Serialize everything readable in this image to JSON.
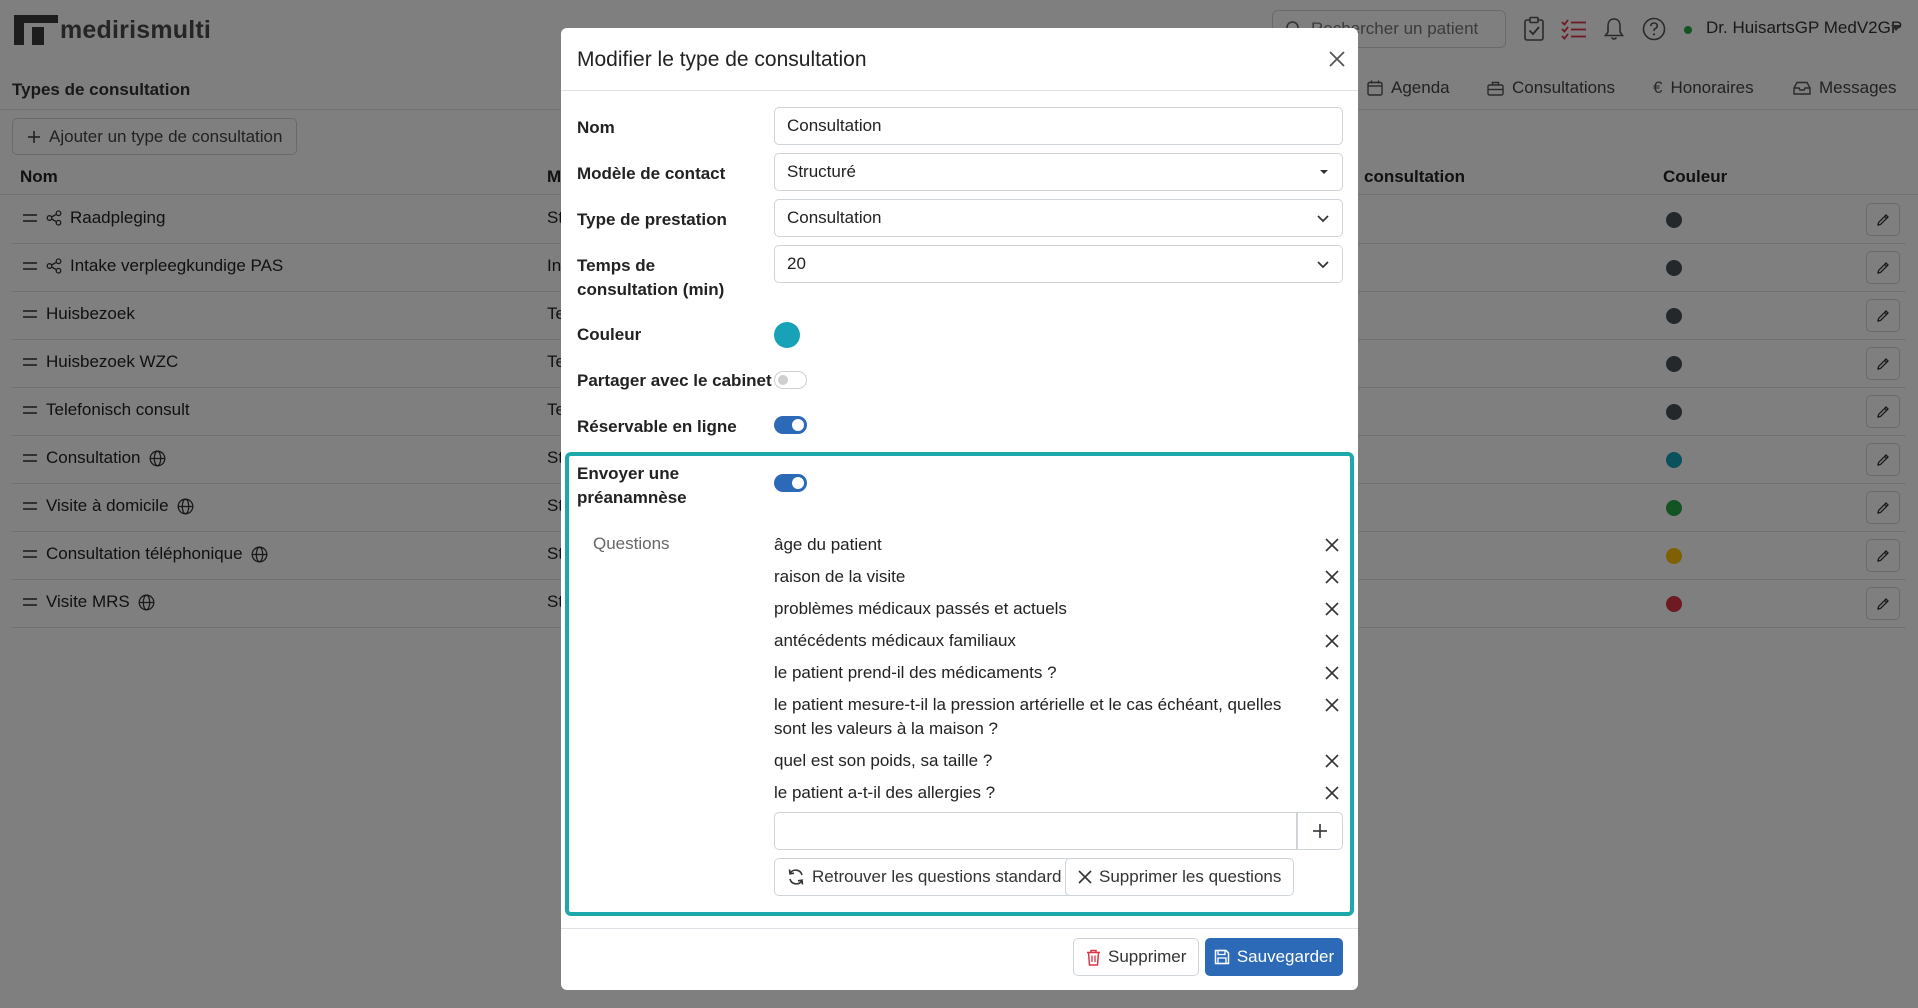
{
  "app": {
    "logo_bold": "medirismulti",
    "search_placeholder": "Rechercher un patient",
    "user_name": "Dr. HuisartsGP MedV2GP",
    "page_heading": "Types de consultation",
    "nav_tabs": [
      "Agenda",
      "Consultations",
      "Honoraires",
      "Messages"
    ],
    "add_button": "Ajouter un type de consultation",
    "columns": {
      "name": "Nom",
      "model": "M",
      "consultation": "consultation",
      "color": "Couleur"
    },
    "rows": [
      {
        "name": "Raadpleging",
        "icon": "share-icon",
        "model": "St",
        "color": "#495057"
      },
      {
        "name": "Intake verpleegkundige PAS",
        "icon": "share-icon",
        "model": "In",
        "color": "#495057"
      },
      {
        "name": "Huisbezoek",
        "icon": "",
        "model": "Te",
        "color": "#495057"
      },
      {
        "name": "Huisbezoek WZC",
        "icon": "",
        "model": "Te",
        "color": "#495057"
      },
      {
        "name": "Telefonisch consult",
        "icon": "",
        "model": "Te",
        "color": "#495057"
      },
      {
        "name": "Consultation",
        "icon": "globe-icon",
        "model": "St",
        "color": "#17a2b8"
      },
      {
        "name": "Visite à domicile",
        "icon": "globe-icon",
        "model": "St",
        "color": "#28a745"
      },
      {
        "name": "Consultation téléphonique",
        "icon": "globe-icon",
        "model": "St",
        "color": "#ffc107"
      },
      {
        "name": "Visite MRS",
        "icon": "globe-icon",
        "model": "St",
        "color": "#dc3545"
      }
    ]
  },
  "modal": {
    "title": "Modifier le type de consultation",
    "fields": {
      "name_label": "Nom",
      "name_value": "Consultation",
      "contact_model_label": "Modèle de contact",
      "contact_model_value": "Structuré",
      "service_type_label": "Type de prestation",
      "service_type_value": "Consultation",
      "duration_label": "Temps de consultation (min)",
      "duration_value": "20",
      "color_label": "Couleur",
      "color_value": "#17a2b8",
      "share_label": "Partager avec le cabinet",
      "share_on": false,
      "online_label": "Réservable en ligne",
      "online_on": true,
      "pre_anamnesis_label": "Envoyer une préanamnèse",
      "pre_anamnesis_on": true
    },
    "questions_label": "Questions",
    "questions": [
      "âge du patient",
      "raison de la visite",
      "problèmes médicaux passés et actuels",
      "antécédents médicaux familiaux",
      "le patient prend-il des médicaments ?",
      "le patient mesure-t-il la pression artérielle et le cas échéant, quelles sont les valeurs à la maison ?",
      "quel est son poids, sa taille ?",
      "le patient a-t-il des allergies ?"
    ],
    "new_question_value": "",
    "restore_button": "Retrouver les questions standard",
    "clear_button": "Supprimer les questions",
    "delete_button": "Supprimer",
    "save_button": "Sauvegarder"
  }
}
